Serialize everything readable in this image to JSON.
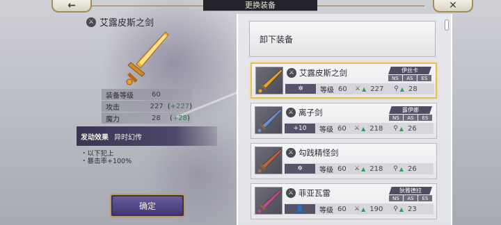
{
  "header": {
    "title": "更换装备"
  },
  "nav": {
    "back_glyph": "←",
    "close_glyph": "✕"
  },
  "selected": {
    "name": "艾露皮斯之剑",
    "stats": [
      {
        "label": "装备等级",
        "value": "60",
        "bonus": ""
      },
      {
        "label": "攻击",
        "value": "227",
        "bonus": "+227"
      },
      {
        "label": "魔力",
        "value": "28",
        "bonus": "+28"
      }
    ],
    "skill_key": "发动效果",
    "skill_name": "异时幻传",
    "effects": [
      "・以下犯上",
      "・暴击率+100%"
    ]
  },
  "confirm_label": "确定",
  "unequip_label": "卸下装备",
  "list_labels": {
    "level": "等级"
  },
  "items": [
    {
      "name": "艾露皮斯之剑",
      "slot": "✲",
      "level": "60",
      "atk": "227",
      "mag": "28",
      "owner": "伊丝卡",
      "modes": [
        "NS",
        "AS",
        "ES"
      ],
      "selected": true,
      "blade": "#e9a126"
    },
    {
      "name": "离子剑",
      "slot": "+10",
      "level": "60",
      "atk": "218",
      "mag": "26",
      "owner": "露伊娜",
      "modes": [
        "NS",
        "AS",
        "ES"
      ],
      "selected": false,
      "blade": "#6a8fc8"
    },
    {
      "name": "勾践精怪剑",
      "slot": "✲",
      "level": "60",
      "atk": "218",
      "mag": "26",
      "owner": "",
      "modes": [],
      "selected": false,
      "blade": "#c0623a"
    },
    {
      "name": "菲亚瓦雷",
      "slot": "👤",
      "level": "60",
      "atk": "190",
      "mag": "23",
      "owner": "狄雅德拉",
      "modes": [
        "NS",
        "AS",
        "ES"
      ],
      "selected": false,
      "blade": "#c04a8a"
    }
  ],
  "colors": {
    "accent_gold": "#e2c15a",
    "panel_dark": "#3a3552",
    "bonus_green": "#2f7d4e"
  }
}
